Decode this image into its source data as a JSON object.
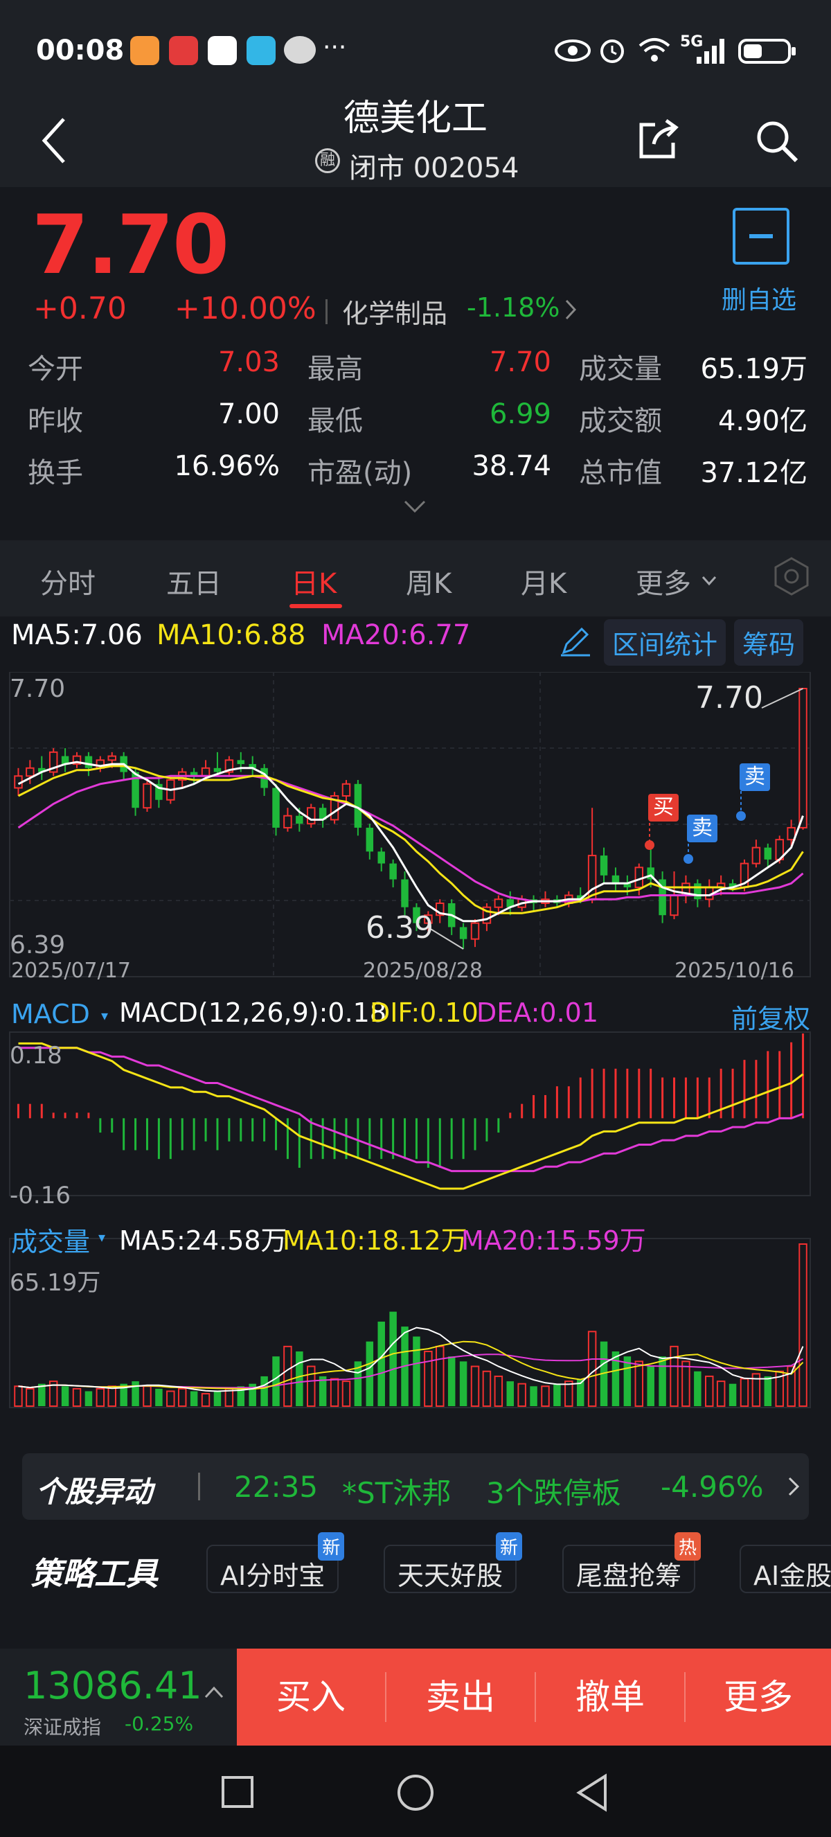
{
  "status_bar": {
    "time": "00:08",
    "icons": [
      "notification-icon",
      "app-icon-1111",
      "sina-icon",
      "book-icon",
      "wechat-icon",
      "more-dots-icon"
    ],
    "right_icons": [
      "eye-icon",
      "alarm-icon",
      "wifi-icon",
      "5g-signal-icon",
      "battery-icon"
    ],
    "more": "···",
    "signal_label": "5G"
  },
  "header": {
    "title": "德美化工",
    "subtitle_prefix": "融",
    "subtitle": "闭市 002054",
    "back_icon": "back-arrow-icon",
    "share_icon": "share-icon",
    "search_icon": "search-icon"
  },
  "quote": {
    "price": "7.70",
    "change": "+0.70",
    "change_pct": "+10.00%",
    "sector": "化学制品",
    "sector_change": "-1.18%",
    "remove_watch_label": "删自选",
    "remove_watch_symbol": "−",
    "rows": [
      [
        {
          "label": "今开",
          "value": "7.03",
          "color": "red"
        },
        {
          "label": "最高",
          "value": "7.70",
          "color": "red"
        },
        {
          "label": "成交量",
          "value": "65.19万",
          "color": "white"
        }
      ],
      [
        {
          "label": "昨收",
          "value": "7.00",
          "color": "white"
        },
        {
          "label": "最低",
          "value": "6.99",
          "color": "green"
        },
        {
          "label": "成交额",
          "value": "4.90亿",
          "color": "white"
        }
      ],
      [
        {
          "label": "换手",
          "value": "16.96%",
          "color": "white"
        },
        {
          "label": "市盈(动)",
          "value": "38.74",
          "color": "white"
        },
        {
          "label": "总市值",
          "value": "37.12亿",
          "color": "white"
        }
      ]
    ]
  },
  "tabs": {
    "items": [
      "分时",
      "五日",
      "日K",
      "周K",
      "月K",
      "更多"
    ],
    "active_index": 2,
    "settings_icon": "hexagon-settings-icon"
  },
  "kline": {
    "ma_labels": {
      "ma5": "MA5:7.06",
      "ma10": "MA10:6.88",
      "ma20": "MA20:6.77"
    },
    "range_stats_label": "区间统计",
    "chips_label": "筹码",
    "y_top": "7.70",
    "y_bottom": "6.39",
    "dates": [
      "2025/07/17",
      "2025/08/28",
      "2025/10/16"
    ],
    "high_label": "7.70",
    "low_label": "6.39",
    "buy_tag": "买",
    "sell_tag": "卖"
  },
  "macd": {
    "title": "MACD",
    "params": "MACD(12,26,9):0.18",
    "dif": "DIF:0.10",
    "dea": "DEA:0.01",
    "adjust_label": "前复权",
    "y_top": "0.18",
    "y_bottom": "-0.16"
  },
  "volume": {
    "title": "成交量",
    "ma5": "MA5:24.58万",
    "ma10": "MA10:18.12万",
    "ma20": "MA20:15.59万",
    "y_top": "65.19万"
  },
  "news_ticker": {
    "brand": "个股异动",
    "time": "22:35",
    "stock": "*ST沐邦",
    "event": "3个跌停板",
    "change": "-4.96%"
  },
  "strategy_tools": {
    "title": "策略工具",
    "items": [
      {
        "label": "AI分时宝",
        "tag": "新"
      },
      {
        "label": "天天好股",
        "tag": "新"
      },
      {
        "label": "尾盘抢筹",
        "tag": "热"
      },
      {
        "label": "AI金股",
        "tag": ""
      }
    ]
  },
  "bottom": {
    "index_value": "13086.41",
    "index_name": "深证成指",
    "index_change": "-0.25%",
    "actions": [
      "买入",
      "卖出",
      "撤单",
      "更多"
    ]
  },
  "chart_data": {
    "type": "candlestick",
    "ylim": [
      6.39,
      7.7
    ],
    "x_labels": [
      "2025/07/17",
      "2025/08/28",
      "2025/10/16"
    ],
    "candles": [
      [
        7.2,
        7.26,
        7.16,
        7.3
      ],
      [
        7.26,
        7.3,
        7.22,
        7.34
      ],
      [
        7.3,
        7.28,
        7.24,
        7.36
      ],
      [
        7.28,
        7.38,
        7.26,
        7.4
      ],
      [
        7.36,
        7.32,
        7.28,
        7.4
      ],
      [
        7.32,
        7.36,
        7.3,
        7.38
      ],
      [
        7.36,
        7.3,
        7.26,
        7.38
      ],
      [
        7.3,
        7.34,
        7.28,
        7.36
      ],
      [
        7.34,
        7.36,
        7.3,
        7.38
      ],
      [
        7.36,
        7.28,
        7.24,
        7.38
      ],
      [
        7.28,
        7.1,
        7.06,
        7.3
      ],
      [
        7.1,
        7.22,
        7.08,
        7.24
      ],
      [
        7.22,
        7.14,
        7.1,
        7.26
      ],
      [
        7.14,
        7.24,
        7.12,
        7.26
      ],
      [
        7.24,
        7.28,
        7.2,
        7.3
      ],
      [
        7.28,
        7.26,
        7.22,
        7.3
      ],
      [
        7.26,
        7.3,
        7.24,
        7.34
      ],
      [
        7.3,
        7.28,
        7.26,
        7.38
      ],
      [
        7.28,
        7.34,
        7.26,
        7.36
      ],
      [
        7.34,
        7.32,
        7.28,
        7.38
      ],
      [
        7.32,
        7.3,
        7.26,
        7.36
      ],
      [
        7.3,
        7.2,
        7.16,
        7.32
      ],
      [
        7.2,
        7.0,
        6.96,
        7.22
      ],
      [
        7.0,
        7.06,
        6.98,
        7.1
      ],
      [
        7.06,
        7.02,
        6.98,
        7.1
      ],
      [
        7.02,
        7.1,
        7.0,
        7.12
      ],
      [
        7.1,
        7.04,
        7.0,
        7.12
      ],
      [
        7.04,
        7.16,
        7.02,
        7.18
      ],
      [
        7.16,
        7.22,
        7.12,
        7.24
      ],
      [
        7.22,
        7.0,
        6.96,
        7.24
      ],
      [
        7.0,
        6.88,
        6.84,
        7.02
      ],
      [
        6.88,
        6.82,
        6.78,
        6.9
      ],
      [
        6.82,
        6.74,
        6.7,
        6.84
      ],
      [
        6.74,
        6.6,
        6.56,
        6.78
      ],
      [
        6.6,
        6.52,
        6.48,
        6.62
      ],
      [
        6.52,
        6.56,
        6.48,
        6.58
      ],
      [
        6.56,
        6.62,
        6.52,
        6.64
      ],
      [
        6.62,
        6.5,
        6.46,
        6.64
      ],
      [
        6.5,
        6.44,
        6.39,
        6.52
      ],
      [
        6.44,
        6.52,
        6.4,
        6.54
      ],
      [
        6.52,
        6.6,
        6.48,
        6.62
      ],
      [
        6.6,
        6.64,
        6.56,
        6.66
      ],
      [
        6.64,
        6.6,
        6.56,
        6.68
      ],
      [
        6.6,
        6.64,
        6.58,
        6.66
      ],
      [
        6.64,
        6.62,
        6.58,
        6.66
      ],
      [
        6.62,
        6.64,
        6.6,
        6.68
      ],
      [
        6.64,
        6.62,
        6.6,
        6.66
      ],
      [
        6.62,
        6.66,
        6.6,
        6.68
      ],
      [
        6.66,
        6.64,
        6.62,
        6.7
      ],
      [
        6.64,
        6.86,
        6.62,
        7.1
      ],
      [
        6.86,
        6.76,
        6.72,
        6.9
      ],
      [
        6.76,
        6.72,
        6.68,
        6.8
      ],
      [
        6.72,
        6.7,
        6.66,
        6.76
      ],
      [
        6.7,
        6.8,
        6.66,
        6.82
      ],
      [
        6.8,
        6.74,
        6.7,
        6.9
      ],
      [
        6.74,
        6.56,
        6.52,
        6.78
      ],
      [
        6.56,
        6.66,
        6.54,
        6.78
      ],
      [
        6.66,
        6.72,
        6.62,
        6.76
      ],
      [
        6.72,
        6.64,
        6.6,
        6.74
      ],
      [
        6.64,
        6.7,
        6.6,
        6.74
      ],
      [
        6.7,
        6.72,
        6.66,
        6.76
      ],
      [
        6.72,
        6.7,
        6.68,
        6.74
      ],
      [
        6.7,
        6.82,
        6.68,
        6.84
      ],
      [
        6.82,
        6.9,
        6.8,
        6.94
      ],
      [
        6.9,
        6.84,
        6.8,
        6.92
      ],
      [
        6.84,
        6.94,
        6.82,
        6.96
      ],
      [
        6.94,
        7.0,
        6.9,
        7.04
      ],
      [
        7.0,
        7.7,
        6.99,
        7.7
      ]
    ],
    "ma5": [
      7.22,
      7.25,
      7.28,
      7.3,
      7.32,
      7.33,
      7.32,
      7.31,
      7.32,
      7.32,
      7.27,
      7.24,
      7.2,
      7.19,
      7.2,
      7.22,
      7.25,
      7.27,
      7.29,
      7.3,
      7.3,
      7.27,
      7.21,
      7.14,
      7.08,
      7.04,
      7.04,
      7.08,
      7.12,
      7.1,
      7.06,
      6.98,
      6.9,
      6.8,
      6.7,
      6.61,
      6.57,
      6.56,
      6.53,
      6.53,
      6.54,
      6.57,
      6.6,
      6.62,
      6.63,
      6.63,
      6.63,
      6.64,
      6.64,
      6.69,
      6.72,
      6.72,
      6.72,
      6.74,
      6.76,
      6.7,
      6.68,
      6.67,
      6.66,
      6.66,
      6.69,
      6.7,
      6.72,
      6.76,
      6.8,
      6.84,
      6.9,
      7.06
    ],
    "ma10": [
      7.16,
      7.19,
      7.22,
      7.25,
      7.27,
      7.29,
      7.29,
      7.3,
      7.31,
      7.31,
      7.3,
      7.28,
      7.26,
      7.25,
      7.25,
      7.24,
      7.24,
      7.24,
      7.24,
      7.25,
      7.26,
      7.26,
      7.24,
      7.21,
      7.19,
      7.17,
      7.15,
      7.14,
      7.13,
      7.1,
      7.05,
      7.01,
      6.98,
      6.94,
      6.88,
      6.83,
      6.77,
      6.72,
      6.66,
      6.61,
      6.58,
      6.57,
      6.57,
      6.57,
      6.58,
      6.59,
      6.6,
      6.62,
      6.63,
      6.66,
      6.68,
      6.68,
      6.68,
      6.69,
      6.72,
      6.7,
      6.7,
      6.7,
      6.7,
      6.7,
      6.7,
      6.69,
      6.7,
      6.71,
      6.73,
      6.76,
      6.79,
      6.88
    ],
    "ma20": [
      7.0,
      7.04,
      7.08,
      7.12,
      7.15,
      7.18,
      7.2,
      7.22,
      7.23,
      7.24,
      7.25,
      7.25,
      7.25,
      7.26,
      7.26,
      7.26,
      7.26,
      7.26,
      7.26,
      7.26,
      7.26,
      7.25,
      7.24,
      7.22,
      7.2,
      7.18,
      7.16,
      7.14,
      7.12,
      7.1,
      7.07,
      7.04,
      7.01,
      6.97,
      6.93,
      6.89,
      6.85,
      6.81,
      6.77,
      6.73,
      6.7,
      6.67,
      6.65,
      6.64,
      6.63,
      6.63,
      6.63,
      6.63,
      6.63,
      6.64,
      6.64,
      6.64,
      6.65,
      6.65,
      6.66,
      6.66,
      6.66,
      6.66,
      6.66,
      6.66,
      6.67,
      6.67,
      6.67,
      6.68,
      6.69,
      6.7,
      6.72,
      6.77
    ],
    "macd_ylim": [
      -0.16,
      0.18
    ],
    "dif": [
      0.17,
      0.17,
      0.17,
      0.16,
      0.16,
      0.16,
      0.15,
      0.14,
      0.13,
      0.11,
      0.1,
      0.09,
      0.08,
      0.07,
      0.07,
      0.06,
      0.06,
      0.05,
      0.05,
      0.04,
      0.03,
      0.02,
      0.0,
      -0.02,
      -0.04,
      -0.05,
      -0.06,
      -0.07,
      -0.08,
      -0.09,
      -0.1,
      -0.11,
      -0.12,
      -0.13,
      -0.14,
      -0.15,
      -0.16,
      -0.16,
      -0.16,
      -0.15,
      -0.14,
      -0.13,
      -0.12,
      -0.11,
      -0.1,
      -0.09,
      -0.08,
      -0.07,
      -0.06,
      -0.04,
      -0.03,
      -0.03,
      -0.02,
      -0.01,
      -0.01,
      -0.01,
      -0.01,
      0.0,
      0.0,
      0.01,
      0.02,
      0.03,
      0.04,
      0.05,
      0.06,
      0.07,
      0.08,
      0.1
    ],
    "dea": [
      0.16,
      0.16,
      0.16,
      0.16,
      0.16,
      0.16,
      0.15,
      0.15,
      0.14,
      0.14,
      0.13,
      0.12,
      0.12,
      0.11,
      0.1,
      0.09,
      0.08,
      0.08,
      0.07,
      0.06,
      0.05,
      0.04,
      0.03,
      0.02,
      0.01,
      -0.01,
      -0.02,
      -0.03,
      -0.04,
      -0.05,
      -0.06,
      -0.07,
      -0.08,
      -0.09,
      -0.1,
      -0.1,
      -0.11,
      -0.12,
      -0.12,
      -0.12,
      -0.12,
      -0.12,
      -0.12,
      -0.12,
      -0.12,
      -0.11,
      -0.11,
      -0.1,
      -0.1,
      -0.09,
      -0.08,
      -0.08,
      -0.07,
      -0.06,
      -0.06,
      -0.05,
      -0.05,
      -0.04,
      -0.04,
      -0.03,
      -0.03,
      -0.02,
      -0.02,
      -0.01,
      -0.01,
      0.0,
      0.0,
      0.01
    ],
    "volume_ylim": [
      0,
      65.19
    ],
    "volume": [
      8,
      7,
      9,
      10,
      8,
      7,
      6,
      7,
      8,
      9,
      10,
      8,
      7,
      6,
      7,
      6,
      5,
      6,
      7,
      8,
      9,
      12,
      20,
      24,
      22,
      16,
      12,
      11,
      10,
      18,
      26,
      34,
      38,
      32,
      28,
      22,
      24,
      20,
      18,
      16,
      14,
      12,
      10,
      9,
      8,
      8,
      9,
      10,
      11,
      30,
      26,
      22,
      20,
      18,
      16,
      20,
      24,
      18,
      14,
      12,
      10,
      9,
      11,
      13,
      12,
      14,
      16,
      65.19
    ]
  }
}
